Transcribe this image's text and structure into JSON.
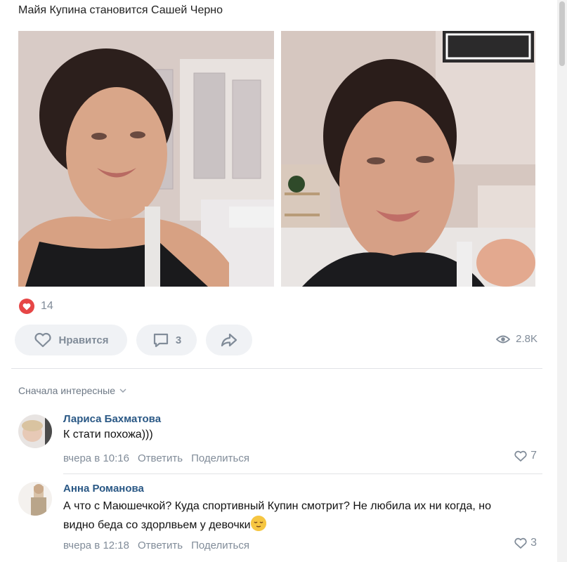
{
  "post": {
    "text": "Майя Купина становится Сашей Черно",
    "likes": "14"
  },
  "actions": {
    "like_label": "Нравится",
    "comments_count": "3",
    "views": "2.8K"
  },
  "comments_section": {
    "sort_label": "Сначала интересные"
  },
  "comments": [
    {
      "author": "Лариса Бахматова",
      "text": "К стати похожа)))",
      "time": "вчера в 10:16",
      "reply": "Ответить",
      "share": "Поделиться",
      "likes": "7"
    },
    {
      "author": "Анна Романова",
      "text": "А что с Маюшечкой? Куда спортивный Купин смотрит? Не любила их ни когда, но видно беда со здорлвьем у девочки",
      "time": "вчера в 12:18",
      "reply": "Ответить",
      "share": "Поделиться",
      "likes": "3"
    }
  ],
  "colors": {
    "like_red": "#e64646",
    "link_blue": "#2a5885",
    "muted": "#818c99",
    "button_bg": "#f0f2f5"
  }
}
